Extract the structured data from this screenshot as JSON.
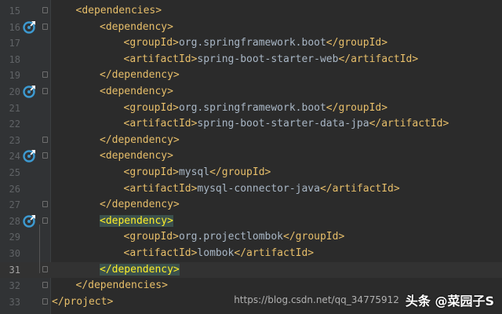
{
  "editor": {
    "lines": [
      {
        "num": "15",
        "indent": 1,
        "parts": [
          {
            "t": "tag",
            "v": "<dependencies>"
          }
        ],
        "icon": false,
        "fold": true
      },
      {
        "num": "16",
        "indent": 2,
        "parts": [
          {
            "t": "tag",
            "v": "<dependency>"
          }
        ],
        "icon": true,
        "fold": true
      },
      {
        "num": "17",
        "indent": 3,
        "parts": [
          {
            "t": "tag",
            "v": "<groupId>"
          },
          {
            "t": "txt",
            "v": "org.springframework.boot"
          },
          {
            "t": "tag",
            "v": "</groupId>"
          }
        ],
        "icon": false,
        "fold": false
      },
      {
        "num": "18",
        "indent": 3,
        "parts": [
          {
            "t": "tag",
            "v": "<artifactId>"
          },
          {
            "t": "txt",
            "v": "spring-boot-starter-web"
          },
          {
            "t": "tag",
            "v": "</artifactId>"
          }
        ],
        "icon": false,
        "fold": false
      },
      {
        "num": "19",
        "indent": 2,
        "parts": [
          {
            "t": "tag",
            "v": "</dependency>"
          }
        ],
        "icon": false,
        "fold": true
      },
      {
        "num": "20",
        "indent": 2,
        "parts": [
          {
            "t": "tag",
            "v": "<dependency>"
          }
        ],
        "icon": true,
        "fold": true
      },
      {
        "num": "21",
        "indent": 3,
        "parts": [
          {
            "t": "tag",
            "v": "<groupId>"
          },
          {
            "t": "txt",
            "v": "org.springframework.boot"
          },
          {
            "t": "tag",
            "v": "</groupId>"
          }
        ],
        "icon": false,
        "fold": false
      },
      {
        "num": "22",
        "indent": 3,
        "parts": [
          {
            "t": "tag",
            "v": "<artifactId>"
          },
          {
            "t": "txt",
            "v": "spring-boot-starter-data-jpa"
          },
          {
            "t": "tag",
            "v": "</artifactId>"
          }
        ],
        "icon": false,
        "fold": false
      },
      {
        "num": "23",
        "indent": 2,
        "parts": [
          {
            "t": "tag",
            "v": "</dependency>"
          }
        ],
        "icon": false,
        "fold": true
      },
      {
        "num": "24",
        "indent": 2,
        "parts": [
          {
            "t": "tag",
            "v": "<dependency>"
          }
        ],
        "icon": true,
        "fold": true
      },
      {
        "num": "25",
        "indent": 3,
        "parts": [
          {
            "t": "tag",
            "v": "<groupId>"
          },
          {
            "t": "txt",
            "v": "mysql"
          },
          {
            "t": "tag",
            "v": "</groupId>"
          }
        ],
        "icon": false,
        "fold": false
      },
      {
        "num": "26",
        "indent": 3,
        "parts": [
          {
            "t": "tag",
            "v": "<artifactId>"
          },
          {
            "t": "txt",
            "v": "mysql-connector-java"
          },
          {
            "t": "tag",
            "v": "</artifactId>"
          }
        ],
        "icon": false,
        "fold": false
      },
      {
        "num": "27",
        "indent": 2,
        "parts": [
          {
            "t": "tag",
            "v": "</dependency>"
          }
        ],
        "icon": false,
        "fold": true
      },
      {
        "num": "28",
        "indent": 2,
        "parts": [
          {
            "t": "hl",
            "v": "<dependency>"
          }
        ],
        "icon": true,
        "fold": true
      },
      {
        "num": "29",
        "indent": 3,
        "parts": [
          {
            "t": "tag",
            "v": "<groupId>"
          },
          {
            "t": "txt",
            "v": "org.projectlombok"
          },
          {
            "t": "tag",
            "v": "</groupId>"
          }
        ],
        "icon": false,
        "fold": false
      },
      {
        "num": "30",
        "indent": 3,
        "parts": [
          {
            "t": "tag",
            "v": "<artifactId>"
          },
          {
            "t": "txt",
            "v": "lombok"
          },
          {
            "t": "tag",
            "v": "</artifactId>"
          }
        ],
        "icon": false,
        "fold": false
      },
      {
        "num": "31",
        "indent": 2,
        "parts": [
          {
            "t": "hl",
            "v": "</dependency>"
          }
        ],
        "icon": false,
        "fold": true,
        "current": true
      },
      {
        "num": "32",
        "indent": 1,
        "parts": [
          {
            "t": "tag",
            "v": "</dependencies>"
          }
        ],
        "icon": false,
        "fold": true
      },
      {
        "num": "33",
        "indent": 0,
        "parts": [
          {
            "t": "tag",
            "v": "</project>"
          }
        ],
        "icon": false,
        "fold": true
      }
    ]
  },
  "watermark": {
    "url": "https://blog.csdn.net/qq_34775912",
    "brand": "头条 @菜园子S"
  },
  "colors": {
    "background": "#2b2b2b",
    "tag": "#e8bf6a",
    "text": "#a9b7c6",
    "bracket_highlight_bg": "#3b514d",
    "bracket_highlight_fg": "#ffef28",
    "gutter_icon": "#3d9ad1"
  },
  "icons": {
    "gutter": "maven-dependency-icon",
    "fold": "fold-marker-icon"
  }
}
